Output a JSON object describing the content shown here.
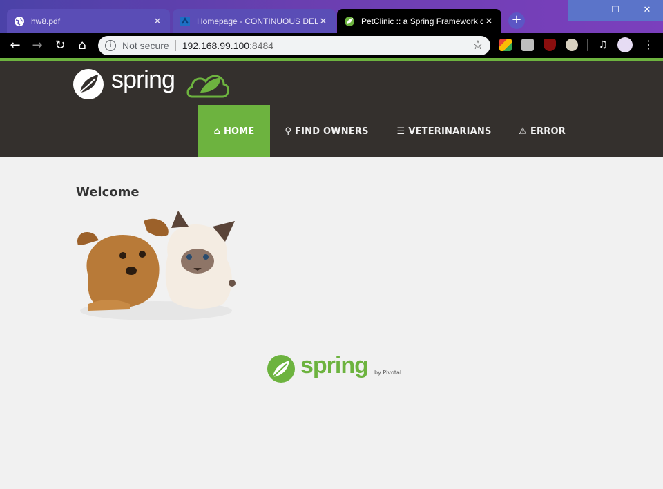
{
  "tabs": [
    {
      "title": "hw8.pdf"
    },
    {
      "title": "Homepage - CONTINUOUS DELI"
    },
    {
      "title": "PetClinic :: a Spring Framework d"
    }
  ],
  "address": {
    "security": "Not secure",
    "host": "192.168.99.100",
    "port": ":8484"
  },
  "menu": {
    "home": "HOME",
    "owners": "FIND OWNERS",
    "vets": "VETERINARIANS",
    "error": "ERROR"
  },
  "page": {
    "heading": "Welcome"
  },
  "footer": {
    "brand": "spring",
    "by": "by Pivotal."
  },
  "header": {
    "brand": "spring"
  },
  "colors": {
    "brand_green": "#6db33f",
    "header_bg": "#34302d",
    "page_bg": "#f1f1f1"
  }
}
